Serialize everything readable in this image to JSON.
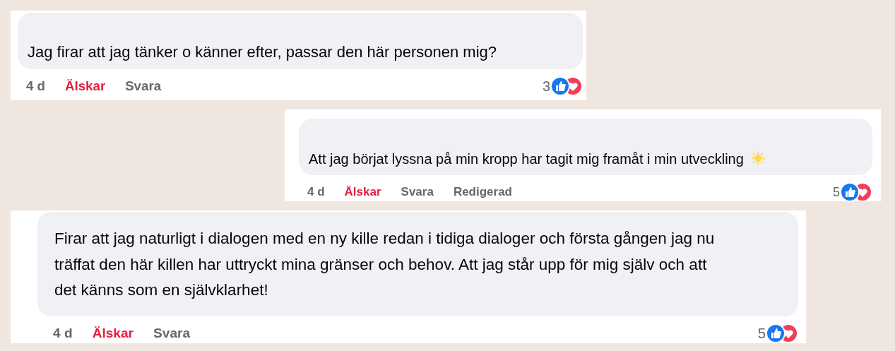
{
  "comments": [
    {
      "text": "Jag firar att jag tänker o känner efter, passar den här personen mig?",
      "emoji": false,
      "time": "4 d",
      "actions": [
        {
          "kind": "reaction",
          "label": "Älskar",
          "selected": true
        },
        {
          "kind": "reply",
          "label": "Svara"
        }
      ],
      "reaction_count": "3"
    },
    {
      "text": "Att jag börjat lyssna på min kropp har tagit mig framåt i min utveckling",
      "emoji": true,
      "time": "4 d",
      "actions": [
        {
          "kind": "reaction",
          "label": "Älskar",
          "selected": true
        },
        {
          "kind": "reply",
          "label": "Svara"
        },
        {
          "kind": "edited",
          "label": "Redigerad"
        }
      ],
      "reaction_count": "5"
    },
    {
      "text": "Firar att jag naturligt i dialogen med en ny kille redan i tidiga dialoger och första gången jag nu träffat den här killen har uttryckt mina gränser och behov. Att jag står upp för mig själv och att det känns som en självklarhet!",
      "emoji": false,
      "time": "4 d",
      "actions": [
        {
          "kind": "reaction",
          "label": "Älskar",
          "selected": true
        },
        {
          "kind": "reply",
          "label": "Svara"
        }
      ],
      "reaction_count": "5"
    }
  ]
}
